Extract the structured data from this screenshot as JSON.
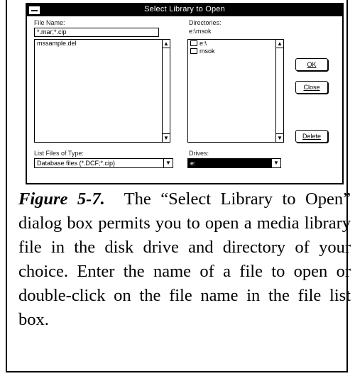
{
  "dialog": {
    "title": "Select Library to Open",
    "file_name_label": "File Name:",
    "file_name_value": "*.mar;*.cip",
    "files": [
      "mssample.del"
    ],
    "directories_label": "Directories:",
    "current_directory": "e:\\msok",
    "directories": [
      "e:\\",
      "msok"
    ],
    "ok_label": "OK",
    "close_label": "Close",
    "delete_label": "Delete",
    "types_label": "List Files of Type:",
    "types_value": "Database files (*.DCF;*.cip)",
    "drives_label": "Drives:",
    "drives_value": "e: "
  },
  "caption": {
    "figure_label": "Figure 5-7.",
    "text": "The “Select Library to Open” dialog box permits you to open a media library file in the disk drive and directory of your choice. Enter the name of a file to open or double-click on the file name in the file list box."
  }
}
